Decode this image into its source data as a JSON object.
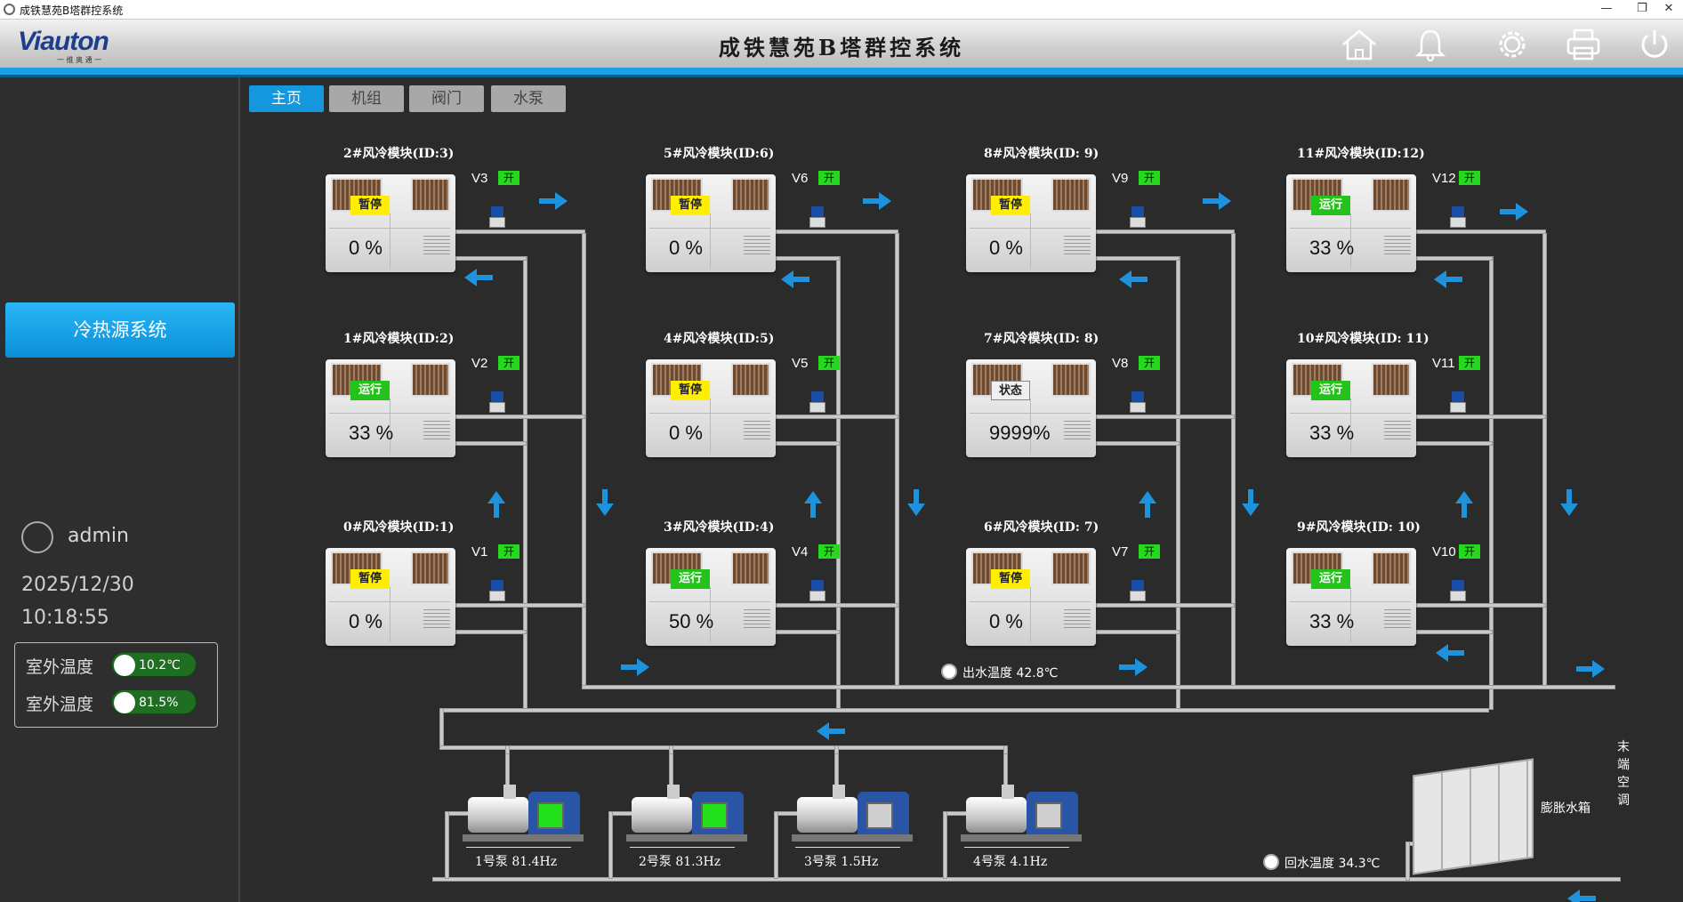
{
  "window": {
    "title": "成铁慧苑B塔群控系统",
    "min": "—",
    "restore": "❐",
    "close": "✕"
  },
  "header": {
    "logo": "Viauton",
    "logo_sub": "一 维 奥 通 一",
    "title": "成铁慧苑B塔群控系统",
    "icons": [
      "home-icon",
      "bell-icon",
      "gear-icon",
      "printer-icon",
      "power-icon"
    ]
  },
  "sidebar": {
    "system_button": "冷热源系统",
    "user": "admin",
    "date": "2025/12/30",
    "time": "10:18:55",
    "env": [
      {
        "label": "室外温度",
        "value": "10.2℃"
      },
      {
        "label": "室外温度",
        "value": "81.5%"
      }
    ]
  },
  "tabs": [
    {
      "label": "主页",
      "active": true
    },
    {
      "label": "机组",
      "active": false
    },
    {
      "label": "阀门",
      "active": false
    },
    {
      "label": "水泵",
      "active": false
    }
  ],
  "modules": [
    {
      "title": "2#风冷模块(ID:3)",
      "status": "暂停",
      "status_color": "yellow",
      "percent": "0 %",
      "valve": "V3",
      "valve_state": "开"
    },
    {
      "title": "5#风冷模块(ID:6)",
      "status": "暂停",
      "status_color": "yellow",
      "percent": "0 %",
      "valve": "V6",
      "valve_state": "开"
    },
    {
      "title": "8#风冷模块(ID: 9)",
      "status": "暂停",
      "status_color": "yellow",
      "percent": "0 %",
      "valve": "V9",
      "valve_state": "开"
    },
    {
      "title": "11#风冷模块(ID:12)",
      "status": "运行",
      "status_color": "green",
      "percent": "33 %",
      "valve": "V12",
      "valve_state": "开"
    },
    {
      "title": "1#风冷模块(ID:2)",
      "status": "运行",
      "status_color": "green",
      "percent": "33 %",
      "valve": "V2",
      "valve_state": "开"
    },
    {
      "title": "4#风冷模块(ID:5)",
      "status": "暂停",
      "status_color": "yellow",
      "percent": "0 %",
      "valve": "V5",
      "valve_state": "开"
    },
    {
      "title": "7#风冷模块(ID: 8)",
      "status": "状态",
      "status_color": "white",
      "percent": "9999%",
      "valve": "V8",
      "valve_state": "开"
    },
    {
      "title": "10#风冷模块(ID: 11)",
      "status": "运行",
      "status_color": "green",
      "percent": "33 %",
      "valve": "V11",
      "valve_state": "开"
    },
    {
      "title": "0#风冷模块(ID:1)",
      "status": "暂停",
      "status_color": "yellow",
      "percent": "0 %",
      "valve": "V1",
      "valve_state": "开"
    },
    {
      "title": "3#风冷模块(ID:4)",
      "status": "运行",
      "status_color": "green",
      "percent": "50 %",
      "valve": "V4",
      "valve_state": "开"
    },
    {
      "title": "6#风冷模块(ID: 7)",
      "status": "暂停",
      "status_color": "yellow",
      "percent": "0 %",
      "valve": "V7",
      "valve_state": "开"
    },
    {
      "title": "9#风冷模块(ID: 10)",
      "status": "运行",
      "status_color": "green",
      "percent": "33 %",
      "valve": "V10",
      "valve_state": "开"
    }
  ],
  "pumps": [
    {
      "name": "1号泵",
      "freq": "81.4Hz",
      "running": true
    },
    {
      "name": "2号泵",
      "freq": "81.3Hz",
      "running": true
    },
    {
      "name": "3号泵",
      "freq": "1.5Hz",
      "running": false
    },
    {
      "name": "4号泵",
      "freq": "4.1Hz",
      "running": false
    }
  ],
  "outlet_temp": {
    "label": "出水温度",
    "value": "42.8℃"
  },
  "return_temp": {
    "label": "回水温度",
    "value": "34.3℃"
  },
  "tank_label": "膨胀水箱",
  "terminal_label": "末端空调",
  "colors": {
    "accent": "#1aa0e6",
    "run": "#24c21a",
    "pause": "#ffee00",
    "pump_on": "#22e01c",
    "pump_off": "#cfcfcf"
  }
}
